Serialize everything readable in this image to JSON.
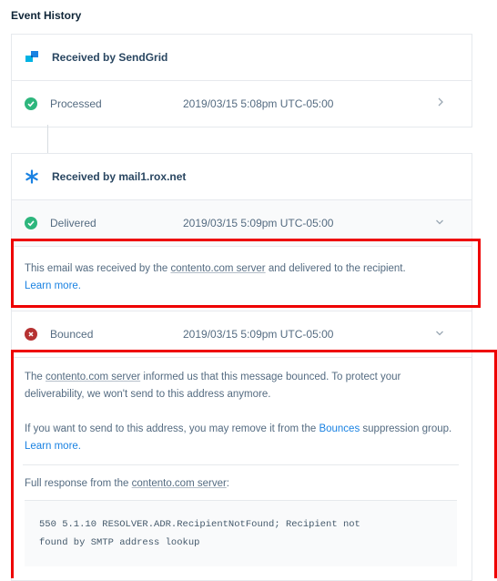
{
  "page_title": "Event History",
  "cards": [
    {
      "header": "Received by SendGrid",
      "header_icon": "sendgrid-logo-icon",
      "events": [
        {
          "status": "Processed",
          "status_icon": "check-circle-icon",
          "time": "2019/03/15 5:08pm UTC-05:00",
          "chevron": "chevron-right-icon"
        }
      ]
    },
    {
      "header": "Received by mail1.rox.net",
      "header_icon": "server-burst-icon",
      "events": [
        {
          "status": "Delivered",
          "status_icon": "check-circle-icon",
          "time": "2019/03/15 5:09pm UTC-05:00",
          "chevron": "chevron-down-icon"
        },
        {
          "status": "Bounced",
          "status_icon": "error-circle-icon",
          "time": "2019/03/15 5:09pm UTC-05:00",
          "chevron": "chevron-down-icon"
        }
      ]
    }
  ],
  "delivered_detail": {
    "text_before": "This email was received by the ",
    "server": "contento.com server",
    "text_after": " and delivered to the recipient.",
    "learn_more": "Learn more."
  },
  "bounced_detail": {
    "line1_link": "contento.com server",
    "line1_before": "The ",
    "line1_after": " informed us that this message bounced. To protect your deliverability, we won't send to this address anymore.",
    "line2_before": "If you want to send to this address, you may remove it from the ",
    "line2_link": "Bounces",
    "line2_after": " suppression group. ",
    "line2_learn": "Learn more.",
    "response_before": "Full response from the ",
    "response_link": "contento.com server",
    "response_after": ":",
    "response_code_line1": "550 5.1.10 RESOLVER.ADR.RecipientNotFound; Recipient not",
    "response_code_line2": "found by SMTP address lookup"
  },
  "colors": {
    "highlight": "#ee0000",
    "success": "#2eb67d",
    "error": "#b63232",
    "link": "#1a82e2"
  }
}
